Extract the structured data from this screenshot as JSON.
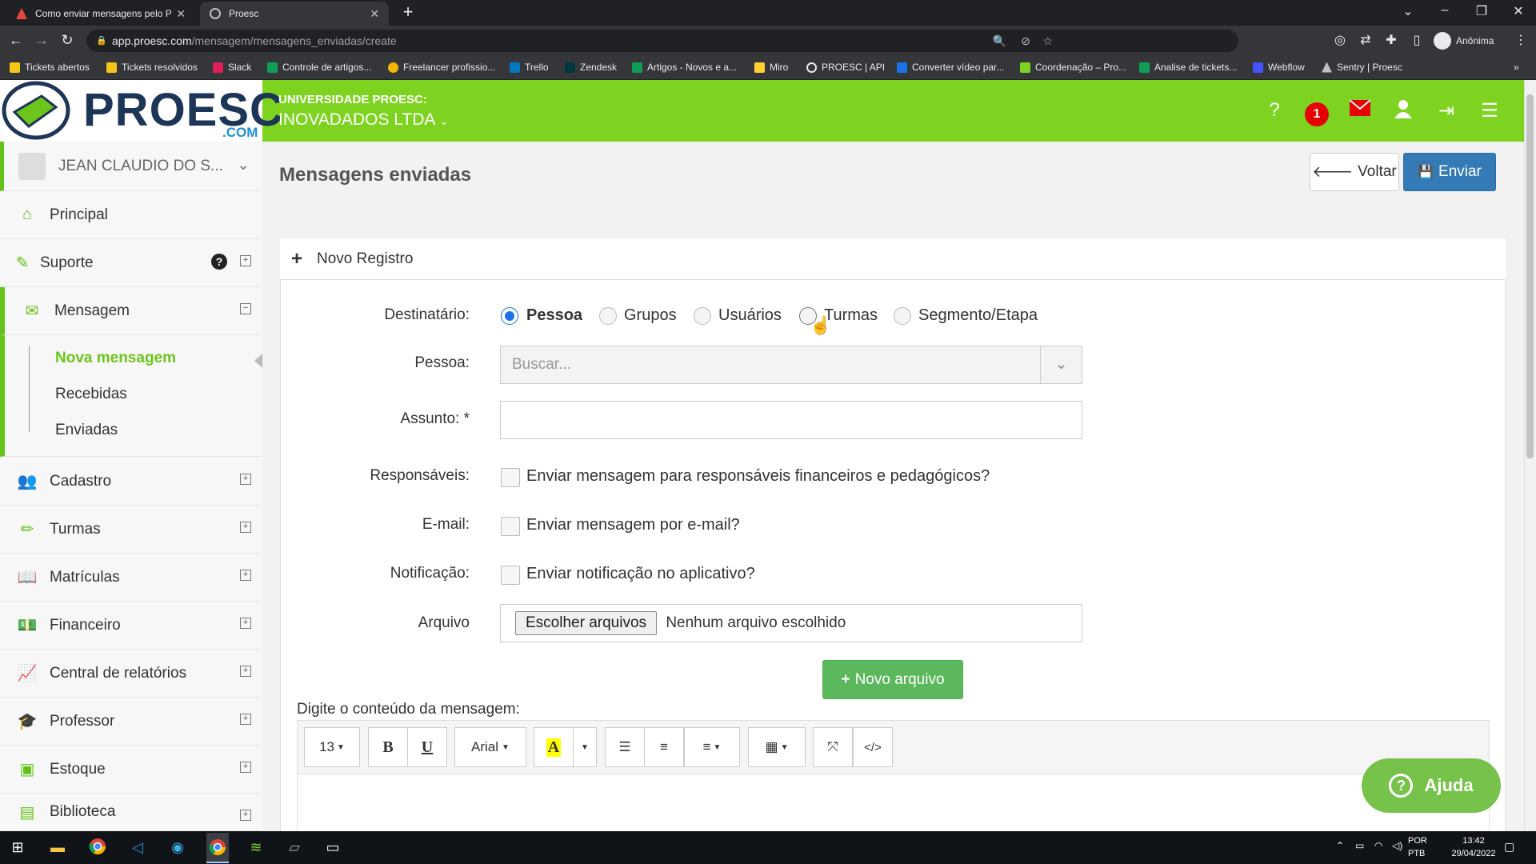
{
  "browser": {
    "tabs": [
      {
        "title": "Como enviar mensagens pelo Pr",
        "active": false
      },
      {
        "title": "Proesc",
        "active": true
      }
    ],
    "url_host": "app.proesc.com",
    "url_path": "/mensagem/mensagens_enviadas/create",
    "profile": "Anônima",
    "bookmarks": [
      "Tickets abertos",
      "Tickets resolvidos",
      "Slack",
      "Controle de artigos...",
      "Freelancer profissio...",
      "Trello",
      "Zendesk",
      "Artigos - Novos e a...",
      "Miro",
      "PROESC | API",
      "Converter vídeo par...",
      "Coordenação – Pro...",
      "Analise de tickets...",
      "Webflow",
      "Sentry | Proesc"
    ]
  },
  "header": {
    "logo_text": "PROESC",
    "logo_suffix": ".COM",
    "university_label": "UNIVERSIDADE PROESC:",
    "company": "INOVADADOS LTDA",
    "notification_count": "1"
  },
  "sidebar": {
    "user_name": "JEAN CLAUDIO DO S...",
    "items": [
      {
        "label": "Principal"
      },
      {
        "label": "Suporte"
      },
      {
        "label": "Mensagem"
      },
      {
        "label": "Cadastro"
      },
      {
        "label": "Turmas"
      },
      {
        "label": "Matrículas"
      },
      {
        "label": "Financeiro"
      },
      {
        "label": "Central de relatórios"
      },
      {
        "label": "Professor"
      },
      {
        "label": "Estoque"
      },
      {
        "label": "Biblioteca"
      }
    ],
    "submenu": [
      {
        "label": "Nova mensagem",
        "active": true
      },
      {
        "label": "Recebidas"
      },
      {
        "label": "Enviadas"
      }
    ]
  },
  "main": {
    "title": "Mensagens enviadas",
    "back_label": "Voltar",
    "send_label": "Enviar",
    "panel_title": "Novo Registro",
    "form": {
      "recipient_label": "Destinatário:",
      "recipient_options": [
        "Pessoa",
        "Grupos",
        "Usuários",
        "Turmas",
        "Segmento/Etapa"
      ],
      "recipient_selected": "Pessoa",
      "person_label": "Pessoa:",
      "person_placeholder": "Buscar...",
      "subject_label": "Assunto: *",
      "subject_value": "",
      "responsibles_label": "Responsáveis:",
      "responsibles_text": "Enviar mensagem para responsáveis financeiros e pedagógicos?",
      "email_label": "E-mail:",
      "email_text": "Enviar mensagem por e-mail?",
      "notification_label": "Notificação:",
      "notification_text": "Enviar notificação no aplicativo?",
      "file_label": "Arquivo",
      "file_button": "Escolher arquivos",
      "file_status": "Nenhum arquivo escolhido",
      "new_file_button": "Novo arquivo",
      "content_label": "Digite o conteúdo da mensagem:"
    },
    "editor_toolbar": {
      "font_size": "13",
      "bold": "B",
      "underline": "U",
      "font_family": "Arial",
      "highlight": "A",
      "code": "</>"
    },
    "help_button": "Ajuda"
  },
  "taskbar": {
    "lang_line1": "POR",
    "lang_line2": "PTB",
    "time": "13:42",
    "date": "29/04/2022"
  },
  "colors": {
    "brand_green": "#7ed321",
    "primary_blue": "#337ab7",
    "success_green": "#5cb85c",
    "badge_red": "#e60000"
  }
}
